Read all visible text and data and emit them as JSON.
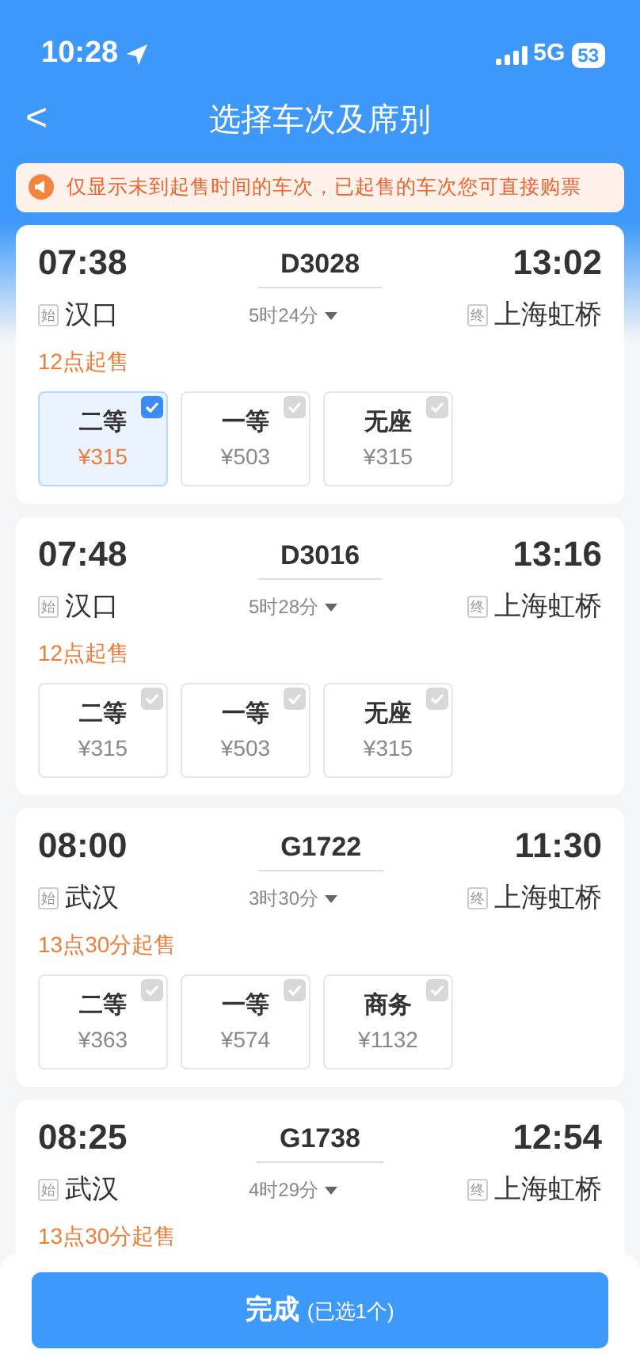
{
  "status_bar": {
    "time": "10:28",
    "network": "5G",
    "battery": "53"
  },
  "header": {
    "back": "<",
    "title": "选择车次及席别"
  },
  "notice": {
    "text": "仅显示未到起售时间的车次，已起售的车次您可直接购票"
  },
  "trains": [
    {
      "depart_time": "07:38",
      "train_no": "D3028",
      "arrive_time": "13:02",
      "start_tag": "始",
      "from": "汉口",
      "duration": "5时24分",
      "end_tag": "终",
      "to": "上海虹桥",
      "sale_time": "12点起售",
      "seats": [
        {
          "name": "二等",
          "price": "¥315",
          "selected": true
        },
        {
          "name": "一等",
          "price": "¥503",
          "selected": false
        },
        {
          "name": "无座",
          "price": "¥315",
          "selected": false
        }
      ]
    },
    {
      "depart_time": "07:48",
      "train_no": "D3016",
      "arrive_time": "13:16",
      "start_tag": "始",
      "from": "汉口",
      "duration": "5时28分",
      "end_tag": "终",
      "to": "上海虹桥",
      "sale_time": "12点起售",
      "seats": [
        {
          "name": "二等",
          "price": "¥315",
          "selected": false
        },
        {
          "name": "一等",
          "price": "¥503",
          "selected": false
        },
        {
          "name": "无座",
          "price": "¥315",
          "selected": false
        }
      ]
    },
    {
      "depart_time": "08:00",
      "train_no": "G1722",
      "arrive_time": "11:30",
      "start_tag": "始",
      "from": "武汉",
      "duration": "3时30分",
      "end_tag": "终",
      "to": "上海虹桥",
      "sale_time": "13点30分起售",
      "seats": [
        {
          "name": "二等",
          "price": "¥363",
          "selected": false
        },
        {
          "name": "一等",
          "price": "¥574",
          "selected": false
        },
        {
          "name": "商务",
          "price": "¥1132",
          "selected": false
        }
      ]
    },
    {
      "depart_time": "08:25",
      "train_no": "G1738",
      "arrive_time": "12:54",
      "start_tag": "始",
      "from": "武汉",
      "duration": "4时29分",
      "end_tag": "终",
      "to": "上海虹桥",
      "sale_time": "13点30分起售"
    }
  ],
  "footer": {
    "button": "完成",
    "button_note": "(已选1个)"
  }
}
